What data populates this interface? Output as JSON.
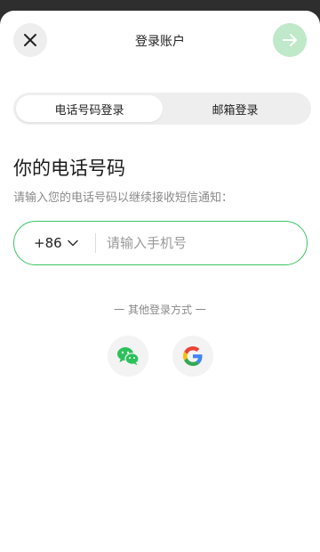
{
  "header": {
    "title": "登录账户",
    "close_icon": "close-icon",
    "next_icon": "arrow-right-icon"
  },
  "tabs": [
    {
      "label": "电话号码登录",
      "active": true
    },
    {
      "label": "邮箱登录",
      "active": false
    }
  ],
  "phone_section": {
    "title": "你的电话号码",
    "subtitle": "请输入您的电话号码以继续接收短信通知：",
    "country_code": "+86",
    "input_value": "",
    "input_placeholder": "请输入手机号"
  },
  "other_login": {
    "label": "一 其他登录方式 一",
    "providers": [
      "wechat-icon",
      "google-icon"
    ]
  },
  "colors": {
    "accent_green": "#3cc463",
    "next_button_disabled": "#bfe9c9",
    "wechat_green": "#2dc15b"
  }
}
